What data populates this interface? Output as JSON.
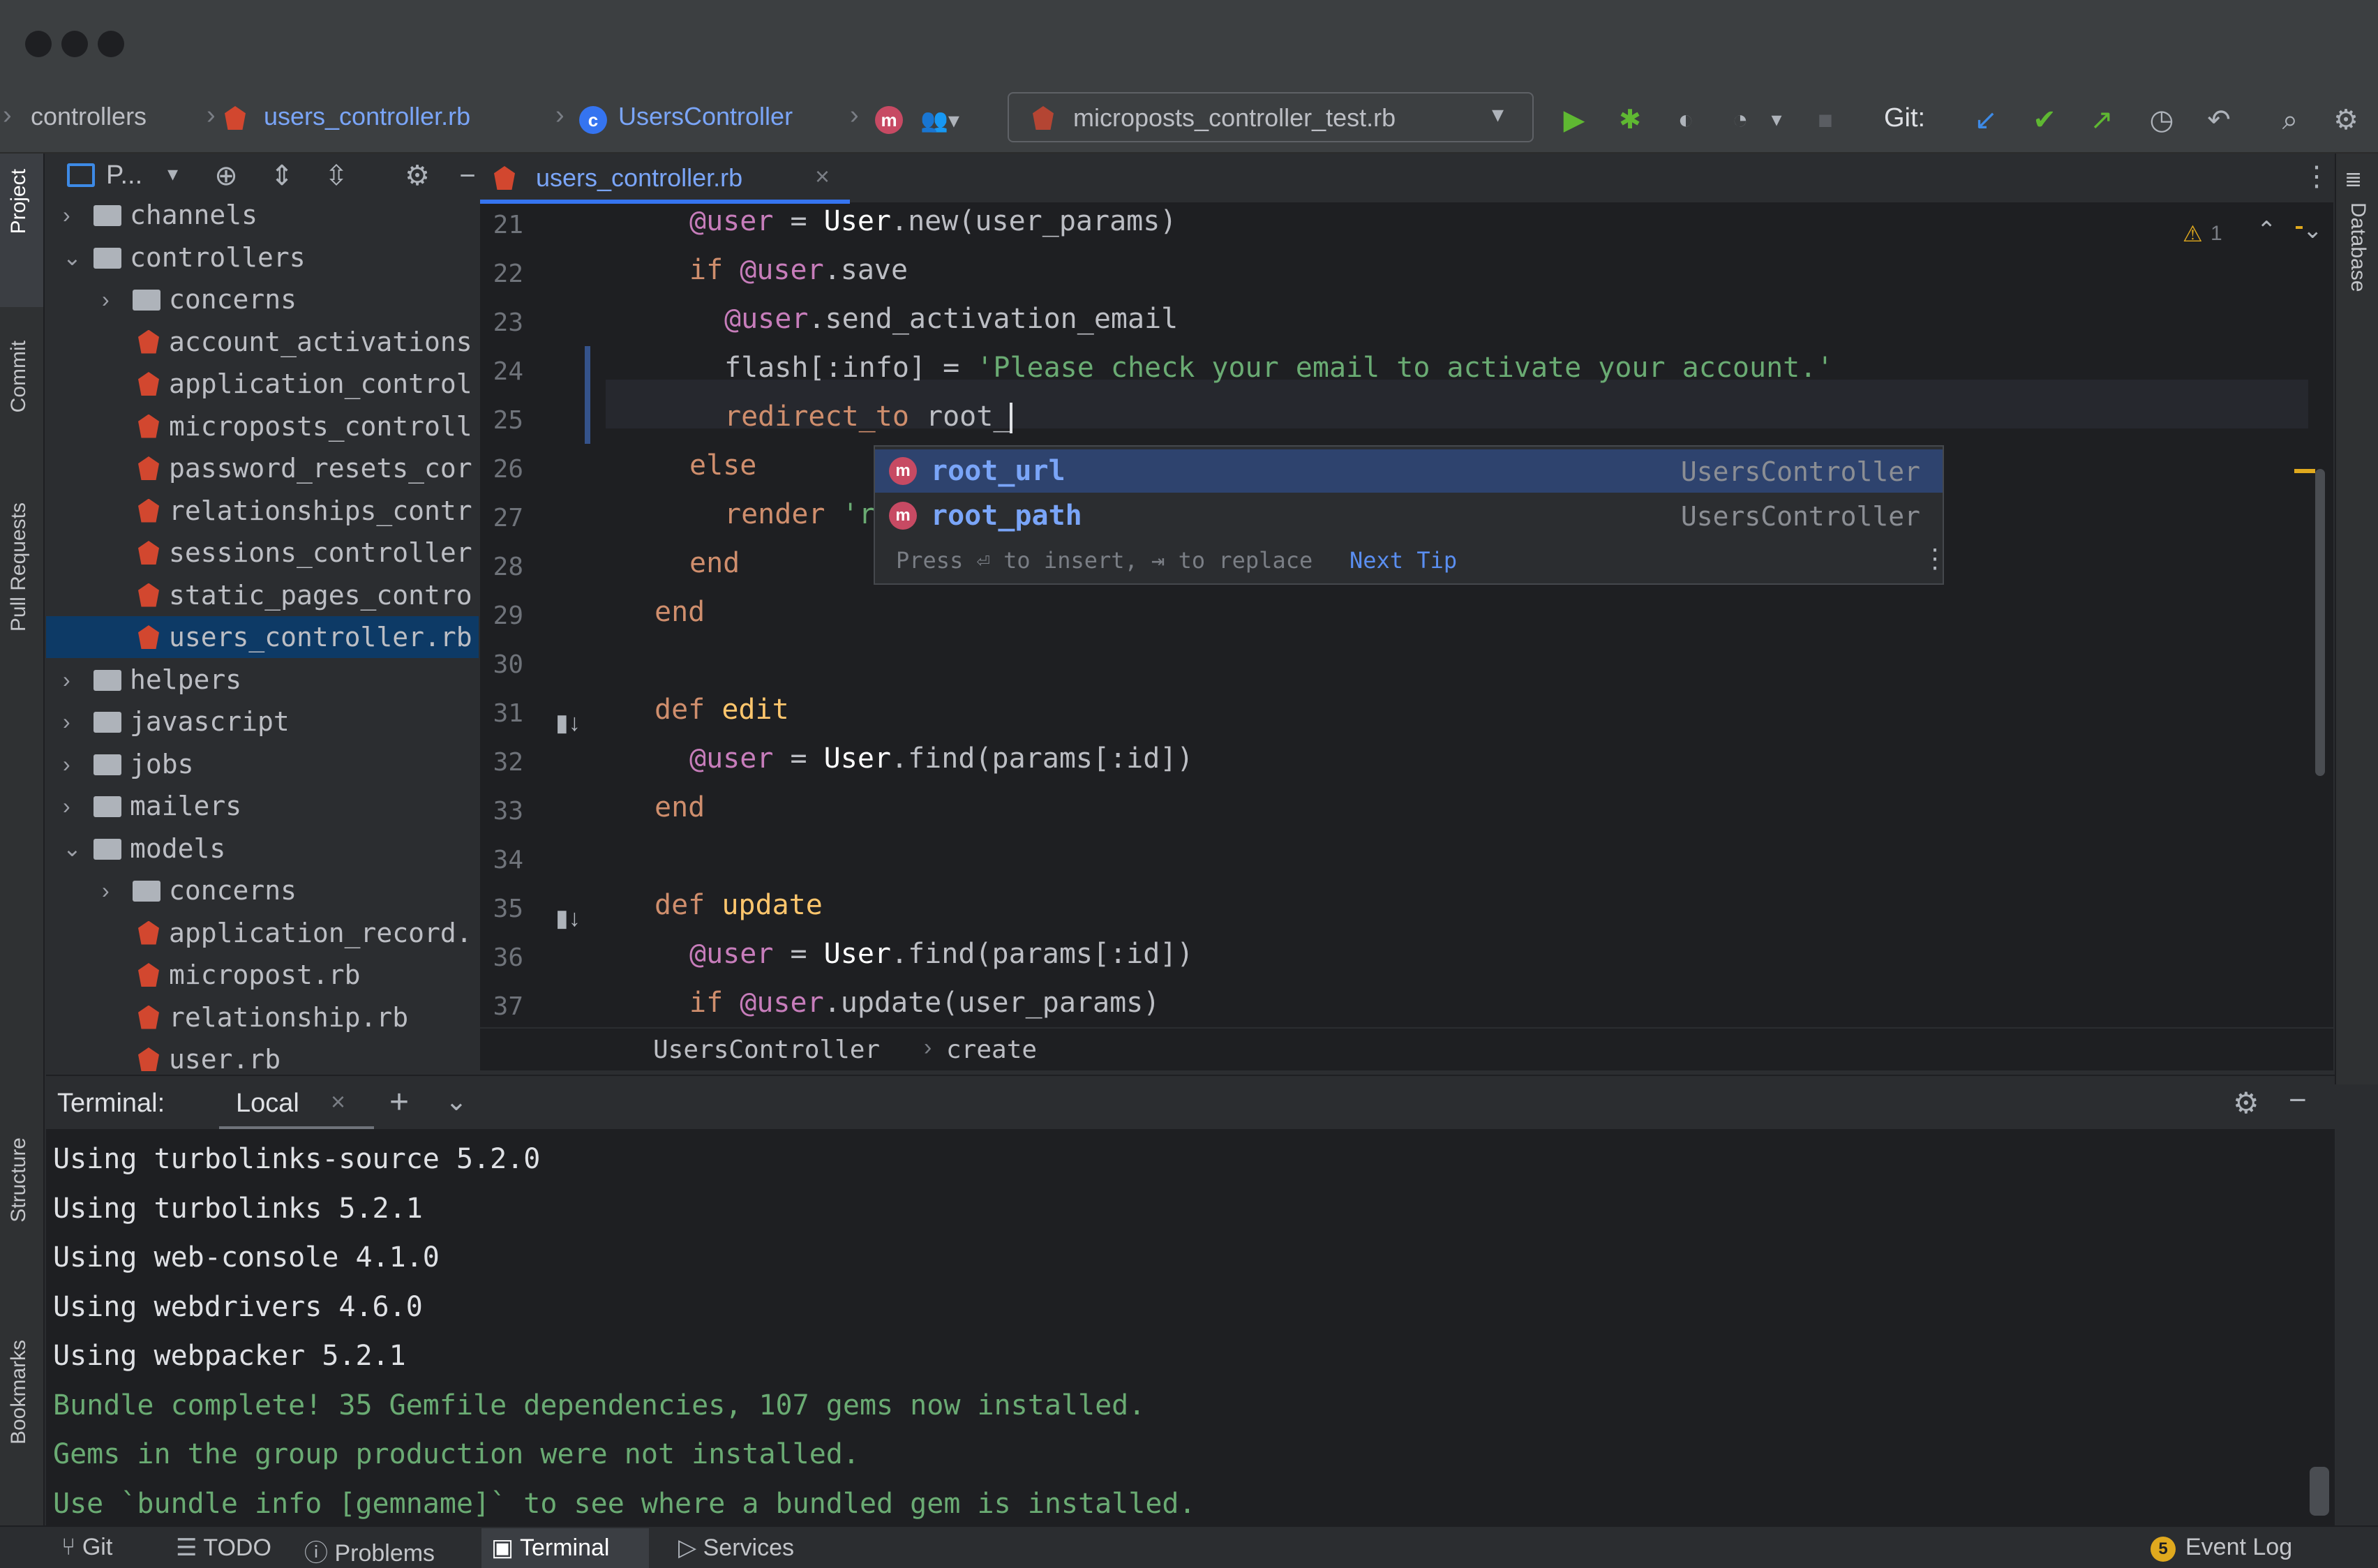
{
  "nav": {
    "breadcrumbs": [
      "controllers",
      "users_controller.rb",
      "UsersController"
    ],
    "run_config": "microposts_controller_test.rb",
    "git_label": "Git:"
  },
  "left_tabs": [
    "Project",
    "Commit",
    "Pull Requests",
    "Structure",
    "Bookmarks"
  ],
  "right_tabs": [
    "Database"
  ],
  "project": {
    "header_label": "P...",
    "tree": [
      {
        "label": "channels",
        "type": "folder",
        "depth": 0,
        "expanded": false
      },
      {
        "label": "controllers",
        "type": "folder",
        "depth": 0,
        "expanded": true
      },
      {
        "label": "concerns",
        "type": "folder",
        "depth": 1,
        "expanded": false
      },
      {
        "label": "account_activations",
        "type": "file",
        "depth": 1
      },
      {
        "label": "application_control",
        "type": "file",
        "depth": 1
      },
      {
        "label": "microposts_controll",
        "type": "file",
        "depth": 1
      },
      {
        "label": "password_resets_cor",
        "type": "file",
        "depth": 1
      },
      {
        "label": "relationships_contr",
        "type": "file",
        "depth": 1
      },
      {
        "label": "sessions_controller",
        "type": "file",
        "depth": 1
      },
      {
        "label": "static_pages_contro",
        "type": "file",
        "depth": 1
      },
      {
        "label": "users_controller.rb",
        "type": "file",
        "depth": 1,
        "selected": true
      },
      {
        "label": "helpers",
        "type": "folder",
        "depth": 0,
        "expanded": false
      },
      {
        "label": "javascript",
        "type": "folder",
        "depth": 0,
        "expanded": false
      },
      {
        "label": "jobs",
        "type": "folder",
        "depth": 0,
        "expanded": false
      },
      {
        "label": "mailers",
        "type": "folder",
        "depth": 0,
        "expanded": false
      },
      {
        "label": "models",
        "type": "folder",
        "depth": 0,
        "expanded": true
      },
      {
        "label": "concerns",
        "type": "folder",
        "depth": 1,
        "expanded": false
      },
      {
        "label": "application_record.",
        "type": "file",
        "depth": 1
      },
      {
        "label": "micropost.rb",
        "type": "file",
        "depth": 1
      },
      {
        "label": "relationship.rb",
        "type": "file",
        "depth": 1
      },
      {
        "label": "user.rb",
        "type": "file",
        "depth": 1
      }
    ]
  },
  "editor": {
    "tab_label": "users_controller.rb",
    "warning_count": "1",
    "line_numbers": [
      "21",
      "22",
      "23",
      "24",
      "25",
      "26",
      "27",
      "28",
      "29",
      "30",
      "31",
      "32",
      "33",
      "34",
      "35",
      "36",
      "37"
    ],
    "breadcrumb": [
      "UsersController",
      "create"
    ]
  },
  "completion": {
    "items": [
      {
        "name": "root_url",
        "owner": "UsersController"
      },
      {
        "name": "root_path",
        "owner": "UsersController"
      }
    ],
    "hint": "Press ⏎ to insert, ⇥ to replace",
    "next_tip": "Next Tip"
  },
  "terminal": {
    "title": "Terminal:",
    "tab": "Local",
    "lines": [
      {
        "text": "Using turbolinks-source 5.2.0",
        "color": "#dfe1e5"
      },
      {
        "text": "Using turbolinks 5.2.1",
        "color": "#dfe1e5"
      },
      {
        "text": "Using web-console 4.1.0",
        "color": "#dfe1e5"
      },
      {
        "text": "Using webdrivers 4.6.0",
        "color": "#dfe1e5"
      },
      {
        "text": "Using webpacker 5.2.1",
        "color": "#dfe1e5"
      },
      {
        "text": "Bundle complete! 35 Gemfile dependencies, 107 gems now installed.",
        "color": "#6aab73"
      },
      {
        "text": "Gems in the group production were not installed.",
        "color": "#6aab73"
      },
      {
        "text": "Use `bundle info [gemname]` to see where a bundled gem is installed.",
        "color": "#6aab73"
      }
    ]
  },
  "statusbar": {
    "items": [
      "Git",
      "TODO",
      "Problems",
      "Terminal",
      "Services"
    ],
    "event_count": "5",
    "event_log": "Event Log"
  },
  "colors": {
    "accent": "#3574f0",
    "selection": "#0d3a66",
    "ruby": "#d2472f",
    "run_green": "#5fb832",
    "string": "#6aab73",
    "keyword": "#cf8e6d"
  }
}
